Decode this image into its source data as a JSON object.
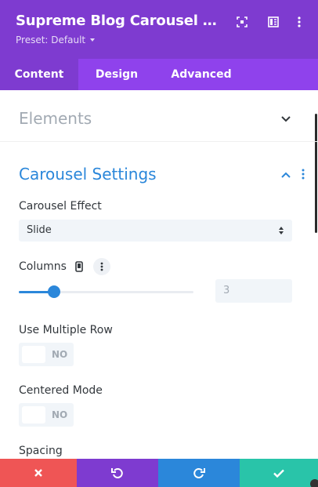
{
  "header": {
    "title": "Supreme Blog Carousel Setti...",
    "preset_label": "Preset: Default",
    "icons": [
      "fullscreen-icon",
      "split-view-icon",
      "more-vertical-icon"
    ]
  },
  "tabs": [
    {
      "label": "Content",
      "active": true
    },
    {
      "label": "Design",
      "active": false
    },
    {
      "label": "Advanced",
      "active": false
    }
  ],
  "sections": {
    "elements": {
      "title": "Elements",
      "expanded": false
    },
    "carousel": {
      "title": "Carousel Settings",
      "expanded": true
    }
  },
  "fields": {
    "carousel_effect": {
      "label": "Carousel Effect",
      "value": "Slide"
    },
    "columns": {
      "label": "Columns",
      "value": "3",
      "slider_fraction": 0.2
    },
    "multiple_row": {
      "label": "Use Multiple Row",
      "state": "NO"
    },
    "centered_mode": {
      "label": "Centered Mode",
      "state": "NO"
    },
    "spacing": {
      "label": "Spacing"
    }
  },
  "footer": {
    "buttons": [
      {
        "name": "discard-icon",
        "color": "#ef5555"
      },
      {
        "name": "undo-icon",
        "color": "#7e3bd0"
      },
      {
        "name": "redo-icon",
        "color": "#2b87da"
      },
      {
        "name": "save-icon",
        "color": "#29c4a9"
      }
    ]
  },
  "colors": {
    "header_purple": "#7e3bd0",
    "tab_bar_purple": "#8f42ec",
    "accent_blue": "#2b87da",
    "muted_gray": "#a2aab3"
  }
}
